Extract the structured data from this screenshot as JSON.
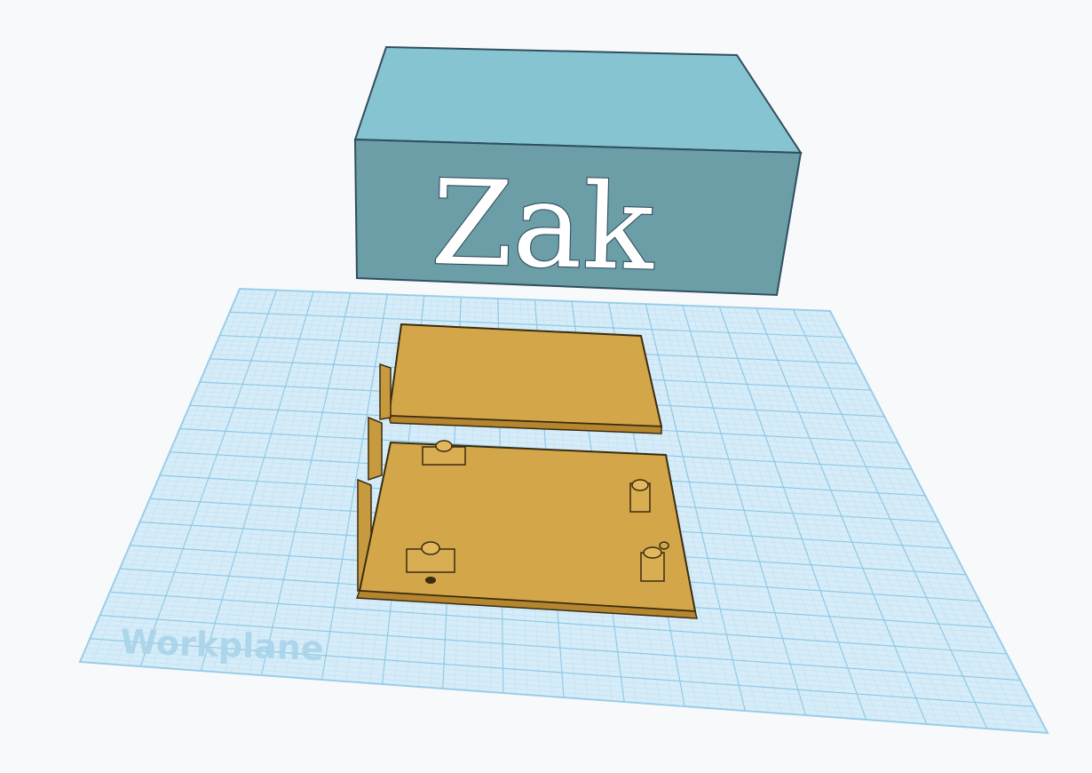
{
  "scene": {
    "workplane_label": "Workplane",
    "box_text": "Zak",
    "colors": {
      "background": "#f8f9fa",
      "workplane_fill": "#cfe9f7",
      "workplane_grid_major": "#8ec9e6",
      "workplane_grid_minor": "#bfe0f2",
      "box_top": "#86c4d1",
      "box_front": "#6c9ea8",
      "box_outline": "#2f4f5f",
      "part_fill": "#d1a447",
      "part_side": "#b5862e",
      "part_outline": "#3a2c10"
    },
    "icons": [
      "workplane-icon",
      "text-shape-icon",
      "box-shape-icon"
    ]
  }
}
